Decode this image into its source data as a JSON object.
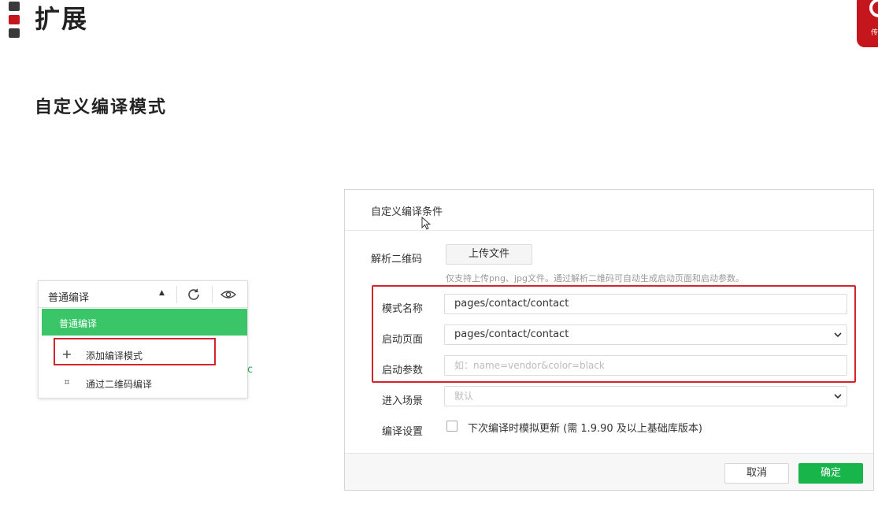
{
  "slide": {
    "title": "扩展",
    "section_title": "自定义编译模式",
    "logo_text": "传"
  },
  "dropdown": {
    "selected": "普通编译",
    "caret_glyph": "▲",
    "active_item": "普通编译",
    "items": [
      {
        "icon": "plus-icon",
        "glyph": "+",
        "label": "添加编译模式"
      },
      {
        "icon": "qrcode-icon",
        "glyph": "⌗",
        "label": "通过二维码编译"
      }
    ],
    "partial_text": "c"
  },
  "dialog": {
    "title": "自定义编译条件",
    "qrcode": {
      "label": "解析二维码",
      "button": "上传文件",
      "hint": "仅支持上传png、jpg文件。通过解析二维码可自动生成启动页面和启动参数。"
    },
    "mode_name": {
      "label": "模式名称",
      "value": "pages/contact/contact"
    },
    "launch_page": {
      "label": "启动页面",
      "value": "pages/contact/contact"
    },
    "launch_params": {
      "label": "启动参数",
      "placeholder": "如：name=vendor&color=black"
    },
    "scene": {
      "label": "进入场景",
      "placeholder": "默认"
    },
    "compile_settings": {
      "label": "编译设置",
      "checkbox_label": "下次编译时模拟更新 (需 1.9.90 及以上基础库版本)",
      "checked": false
    },
    "buttons": {
      "cancel": "取消",
      "confirm": "确定"
    }
  },
  "colors": {
    "brand_red": "#c4161c",
    "highlight_red": "#d4242b",
    "accent_green": "#3ac569",
    "confirm_green": "#17b54a"
  }
}
